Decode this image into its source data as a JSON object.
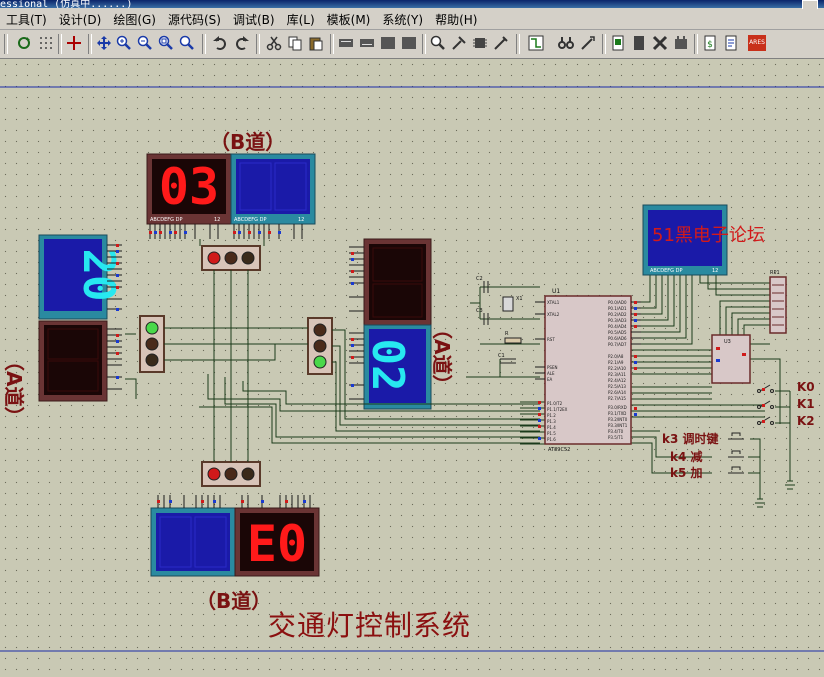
{
  "window": {
    "title_fragment": "essional (仿真中......)"
  },
  "menu": {
    "items": [
      "工具(T)",
      "设计(D)",
      "绘图(G)",
      "源代码(S)",
      "调试(B)",
      "库(L)",
      "模板(M)",
      "系统(Y)",
      "帮助(H)"
    ]
  },
  "toolbar": {
    "icons": [
      "refresh-icon",
      "grid-icon",
      "origin-icon",
      "pan-icon",
      "zoom-in-icon",
      "zoom-out-icon",
      "zoom-all-icon",
      "zoom-area-icon",
      "undo-icon",
      "redo-icon",
      "cut-icon",
      "copy-icon",
      "paste-icon",
      "block-copy-icon",
      "block-move-icon",
      "block-rotate-icon",
      "block-delete-icon",
      "pick-device-icon",
      "make-device-icon",
      "package-tool-icon",
      "decompose-icon",
      "wire-autorouter-icon",
      "search-tag-icon",
      "property-assign-icon",
      "new-sheet-icon",
      "remove-sheet-icon",
      "goto-sheet-icon",
      "zoom-child-icon",
      "bom-icon",
      "netlist-icon",
      "ares-icon"
    ],
    "ares_label": "ARES"
  },
  "schematic": {
    "title": "交通灯控制系统",
    "label_b_top": "（B道）",
    "label_b_bottom": "（B道）",
    "label_a_left": "（A道）",
    "label_a_right": "（A道）",
    "forum_text": "51黑电子论坛",
    "displays": {
      "b_top_red": "03",
      "a_left_blue": "20",
      "a_right_blue": "02",
      "b_bottom_red": "E0"
    },
    "components": {
      "mcu": "U1",
      "ic2": "U3",
      "resnet": "RP1",
      "crystal": "X1",
      "cap1": "C2",
      "cap2": "C3",
      "cap3": "C1",
      "resistor": "R",
      "lcd_label": "AT89C52"
    },
    "keys": [
      "K0",
      "K1",
      "K2"
    ],
    "buttons": [
      "k3 调时键",
      "k4 减",
      "k5 加"
    ],
    "seg_caption": "ABCDEFG DP",
    "seg_caption_pins": "12"
  },
  "colors": {
    "lcd_blue_bg": "#1a1aa8",
    "lcd_border": "#2a8aa0",
    "red_digit": "#ff1a1a",
    "cyan_digit": "#27e8f0",
    "dim_red": "#5a0808",
    "dim_blue": "#12128a",
    "title_red": "#8b1010",
    "wire": "#1a3a1a"
  }
}
